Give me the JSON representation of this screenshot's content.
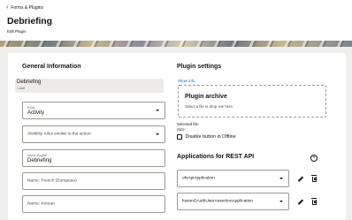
{
  "header": {
    "back_label": "Forms & Plugins",
    "title": "Debriefing",
    "subtitle": "Edit Plugin"
  },
  "general": {
    "heading": "General Information",
    "label_field": {
      "value": "Debriefing",
      "label": "Label"
    },
    "entity": {
      "label": "Entity",
      "value": "Activity"
    },
    "visibility_rules": {
      "placeholder": "Visibility rules similar to the action"
    },
    "name_english": {
      "label": "Name: English",
      "value": "Debriefing"
    },
    "name_french": {
      "placeholder": "Name: French (European)"
    },
    "name_korean": {
      "placeholder": "Name: Korean"
    }
  },
  "plugin": {
    "heading": "Plugin settings",
    "show_info": "Show info",
    "archive_title": "Plugin archive",
    "archive_hint": "Select a file or drop one here.",
    "selected_file_label": "Selected file:",
    "size_label": "Size:",
    "disable_offline_label": "Disable button in Offline"
  },
  "rest": {
    "heading": "Applications for REST API",
    "apps": [
      {
        "value": "ofsApiApplication"
      },
      {
        "value": "fusionOAuthUserAssertionApplication"
      }
    ]
  }
}
